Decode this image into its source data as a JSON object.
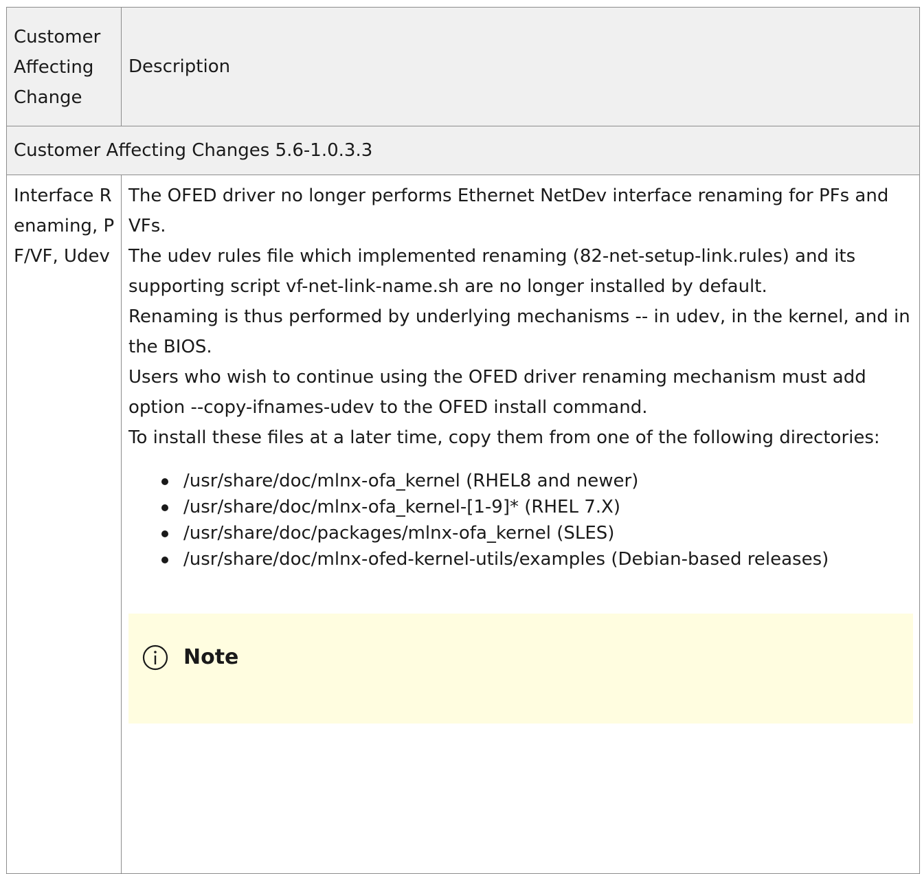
{
  "table": {
    "header": {
      "col1": "Customer Affecting Change",
      "col2": "Description"
    },
    "section_title": "Customer Affecting Changes 5.6-1.0.3.3",
    "row": {
      "change": "Interface Renaming, PF/VF, Udev",
      "description_lines": [
        "The OFED driver no longer performs Ethernet NetDev interface renaming for PFs and VFs.",
        "The udev rules file which implemented renaming (82-net-setup-link.rules) and its supporting script vf-net-link-name.sh are no longer installed by default.",
        "Renaming is thus performed by underlying mechanisms -- in udev, in the kernel, and in the BIOS.",
        "Users who wish to continue using the OFED driver renaming mechanism must add option --copy-ifnames-udev to the OFED install command.",
        "To install these files at a later time, copy them from one of the following directories:"
      ],
      "directories": [
        "/usr/share/doc/mlnx-ofa_kernel (RHEL8 and newer)",
        "/usr/share/doc/mlnx-ofa_kernel-[1-9]* (RHEL 7.X)",
        "/usr/share/doc/packages/mlnx-ofa_kernel (SLES)",
        "/usr/share/doc/mlnx-ofed-kernel-utils/examples (Debian-based releases)"
      ],
      "note": {
        "icon": "info-icon",
        "title": "Note"
      }
    }
  },
  "colors": {
    "header_bg": "#f0f0f0",
    "note_bg": "#fffde0",
    "border": "#8c8c8c"
  }
}
